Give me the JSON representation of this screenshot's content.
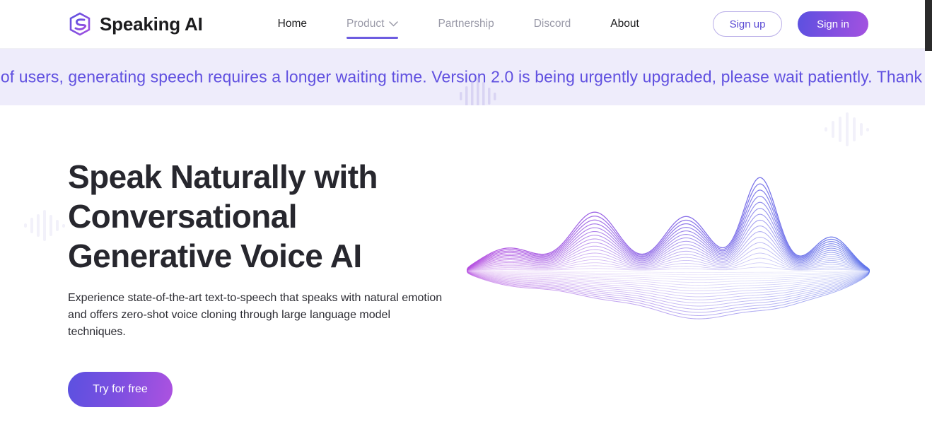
{
  "brand": {
    "name": "Speaking AI",
    "logo_icon": "hexagon-s-logo-icon"
  },
  "nav": {
    "items": [
      {
        "label": "Home",
        "active": true,
        "has_chevron": false,
        "underline": false
      },
      {
        "label": "Product",
        "active": false,
        "has_chevron": true,
        "underline": true
      },
      {
        "label": "Partnership",
        "active": false,
        "has_chevron": false,
        "underline": false
      },
      {
        "label": "Discord",
        "active": false,
        "has_chevron": false,
        "underline": false
      },
      {
        "label": "About",
        "active": true,
        "has_chevron": false,
        "underline": false
      }
    ],
    "chevron_icon": "chevron-down-icon"
  },
  "auth": {
    "sign_up_label": "Sign up",
    "sign_in_label": "Sign in"
  },
  "banner": {
    "text": "Due to the large number of users, generating speech requires a longer waiting time. Version 2.0 is being urgently upgraded, please wait patiently. Thank you for your support.",
    "background_color": "#eeecfb",
    "text_color": "#6050e0"
  },
  "hero": {
    "title_lines": [
      "Speak Naturally with",
      "Conversational",
      "Generative Voice AI"
    ],
    "title": "Speak Naturally with Conversational Generative Voice AI",
    "subtitle": "Experience state-of-the-art text-to-speech that speaks with natural emotion and offers zero-shot voice cloning through large language model techniques.",
    "cta_label": "Try for free",
    "illustration": "audio-waveform-illustration"
  },
  "decor": {
    "equalizer_icon": "equalizer-bars-icon"
  },
  "colors": {
    "accent_purple": "#6d5ce0",
    "gradient_start": "#5b51e0",
    "gradient_end": "#ad52e0",
    "heading": "#27272e",
    "muted_nav": "#9a9aa8"
  },
  "scrollbar": {
    "thumb_color": "#2b2b2b",
    "position": "top"
  }
}
